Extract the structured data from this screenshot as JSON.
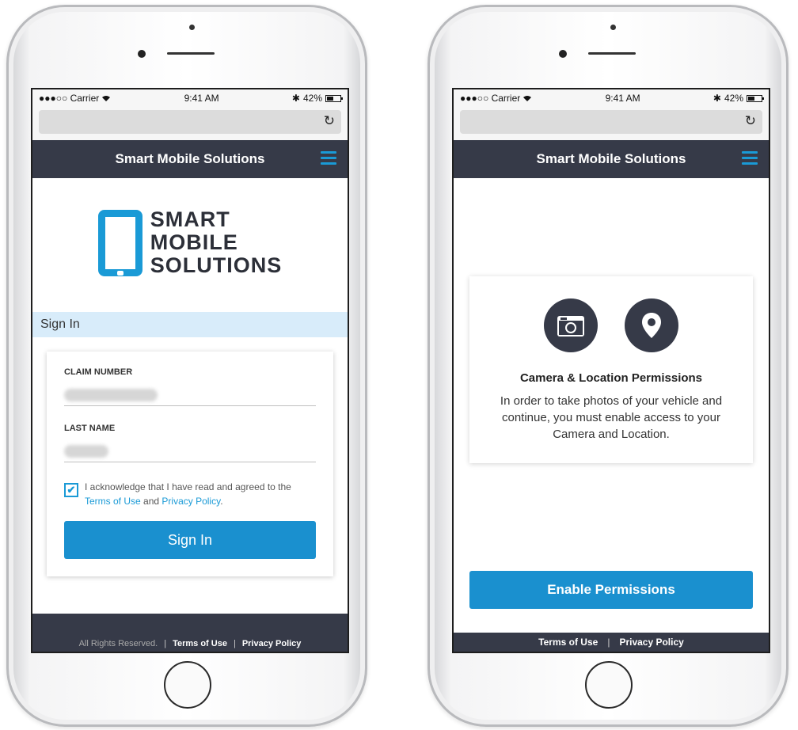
{
  "status_bar": {
    "carrier": "●●●○○ Carrier",
    "wifi": "wifi",
    "time": "9:41 AM",
    "bluetooth": "✱",
    "battery": "42%",
    "battery_level": 0.42
  },
  "browser": {
    "reload_icon": "C"
  },
  "app": {
    "title": "Smart Mobile Solutions",
    "menu_icon": "hamburger-menu"
  },
  "left_screen": {
    "logo": {
      "line1": "SMART",
      "line2": "MOBILE",
      "line3": "SOLUTIONS"
    },
    "section_title": "Sign In",
    "form": {
      "claim_label": "CLAIM NUMBER",
      "last_name_label": "LAST NAME",
      "ack_prefix": "I acknowledge that I have read and agreed to the",
      "terms_link": "Terms of Use",
      "and_text": "and",
      "privacy_link": "Privacy Policy",
      "period": ".",
      "checkbox_checked": true,
      "check_mark": "✔",
      "submit_label": "Sign In"
    },
    "footer": {
      "rights": "All Rights Reserved.",
      "sep": "|",
      "terms": "Terms of Use",
      "privacy": "Privacy Policy"
    }
  },
  "right_screen": {
    "icons": [
      "camera-icon",
      "location-pin-icon"
    ],
    "perm_title": "Camera & Location Permissions",
    "perm_text": "In order to take photos of your vehicle and continue, you must enable access to your Camera and Location.",
    "enable_button": "Enable Permissions",
    "footer": {
      "terms": "Terms of Use",
      "sep": "|",
      "privacy": "Privacy Policy"
    }
  },
  "colors": {
    "accent": "#1a9ad6",
    "header": "#363a48",
    "section_bar": "#d8ecfa"
  }
}
